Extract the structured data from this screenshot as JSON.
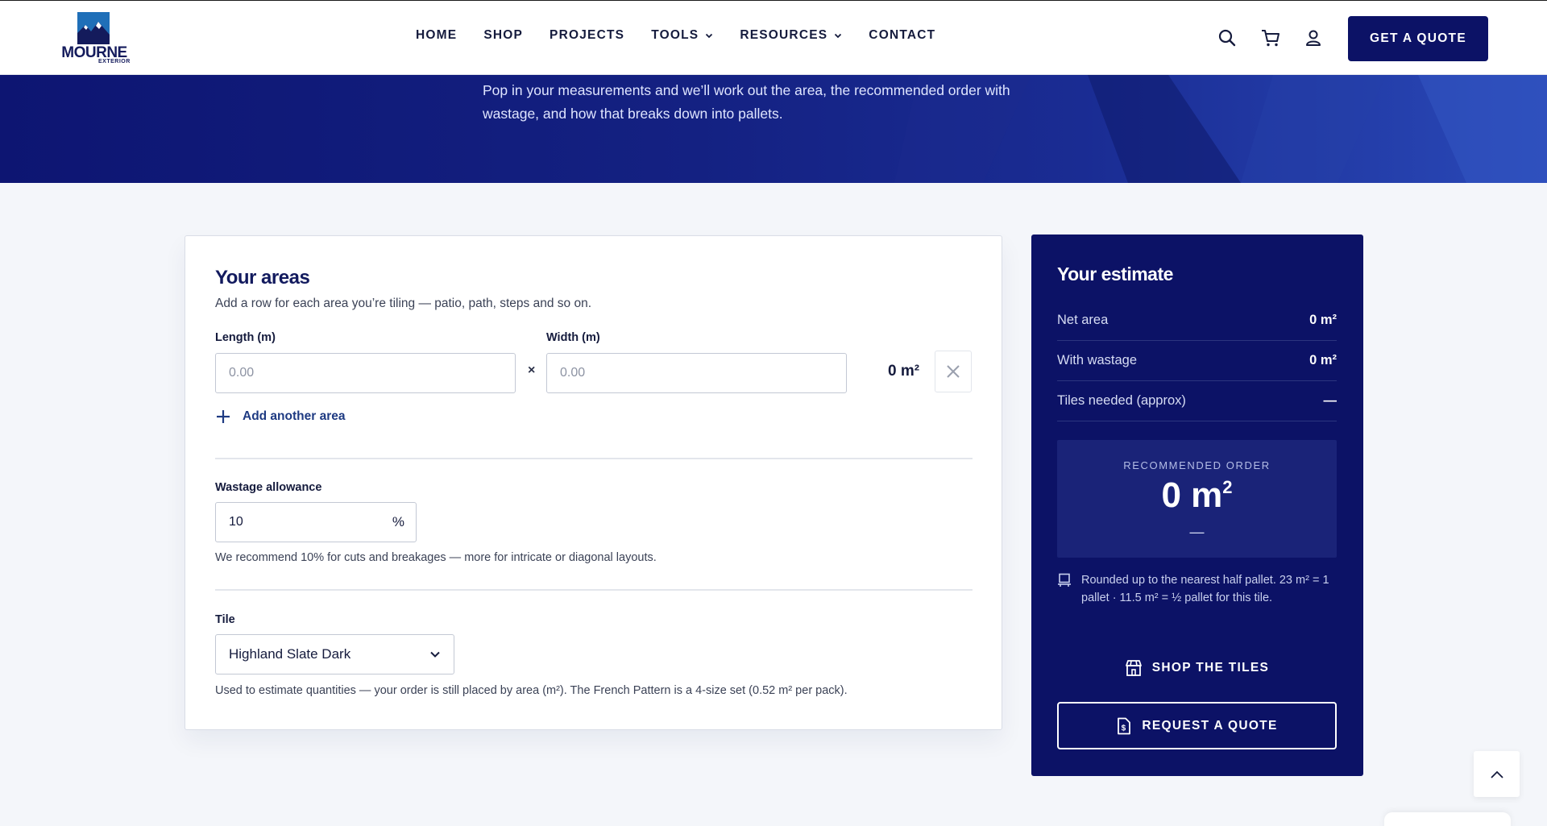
{
  "brand": {
    "name": "MOURNE",
    "sub": "EXTERIOR"
  },
  "nav": {
    "items": [
      {
        "label": "HOME",
        "has_menu": false
      },
      {
        "label": "SHOP",
        "has_menu": false
      },
      {
        "label": "PROJECTS",
        "has_menu": false
      },
      {
        "label": "TOOLS",
        "has_menu": true
      },
      {
        "label": "RESOURCES",
        "has_menu": true
      },
      {
        "label": "CONTACT",
        "has_menu": false
      }
    ],
    "icons": [
      "search-icon",
      "cart-icon",
      "account-icon"
    ],
    "cta_label": "GET A QUOTE"
  },
  "hero": {
    "intro": "Pop in your measurements and we’ll work out the area, the recommended order with wastage, and how that breaks down into pallets."
  },
  "areas": {
    "title": "Your areas",
    "subtitle": "Add a row for each area you’re tiling — patio, path, steps and so on.",
    "length_label": "Length (m)",
    "length_placeholder": "0.00",
    "width_label": "Width (m)",
    "width_placeholder": "0.00",
    "times_symbol": "×",
    "row_area": "0 m²",
    "add_label": "Add another area",
    "wastage_label": "Wastage allowance",
    "wastage_value": "10",
    "wastage_unit": "%",
    "wastage_hint": "We recommend 10% for cuts and breakages — more for intricate or diagonal layouts.",
    "tile_label": "Tile",
    "tile_selected": "Highland Slate Dark",
    "tile_hint": "Used to estimate quantities — your order is still placed by area (m²). The French Pattern is a 4-size set (0.52 m² per pack)."
  },
  "estimate": {
    "title": "Your estimate",
    "rows": [
      {
        "label": "Net area",
        "value": "0 m²"
      },
      {
        "label": "With wastage",
        "value": "0 m²"
      },
      {
        "label": "Tiles needed (approx)",
        "value": "—"
      }
    ],
    "recommended_label": "RECOMMENDED ORDER",
    "recommended_value": "0 m",
    "recommended_unit_sup": "2",
    "recommended_sub": "—",
    "note": "Rounded up to the nearest half pallet. 23 m² = 1 pallet · 11.5 m² = ½ pallet for this tile.",
    "shop_label": "SHOP THE TILES",
    "quote_label": "REQUEST A QUOTE"
  },
  "colors": {
    "brand_navy": "#0c1266",
    "hero_blue": "#142182",
    "page_bg": "#f4f6fa"
  }
}
